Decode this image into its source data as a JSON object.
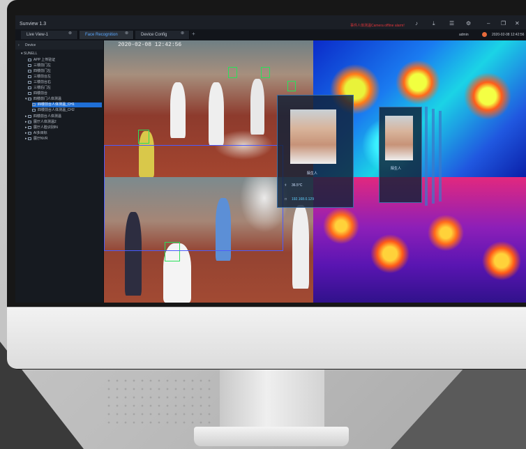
{
  "app": {
    "title": "Sunview 1.3",
    "alarm_text": "事件人体测温Camera offline alarm!",
    "user": "admin",
    "datetime": "2020-02-08 12:42:56"
  },
  "tabs": [
    {
      "label": "Live View-1",
      "active": false
    },
    {
      "label": "Face Recognition",
      "active": true
    },
    {
      "label": "Device Config",
      "active": false
    }
  ],
  "sidebar": {
    "header": "Device",
    "items": [
      {
        "label": "SUNELL",
        "level": 0
      },
      {
        "label": "APP 上传验证",
        "level": 1
      },
      {
        "label": "三楼前门左",
        "level": 1
      },
      {
        "label": "四楼前门左",
        "level": 1
      },
      {
        "label": "三楼前台左",
        "level": 1
      },
      {
        "label": "三楼前台右",
        "level": 1
      },
      {
        "label": "三楼后门左",
        "level": 1
      },
      {
        "label": "四楼前台",
        "level": 1
      },
      {
        "label": "四楼前门人体测温",
        "level": 1
      },
      {
        "label": "四楼前台人体测温_CH1",
        "level": 2,
        "selected": true
      },
      {
        "label": "四楼前台人体测温_CH2",
        "level": 2
      },
      {
        "label": "四楼前台人体测温",
        "level": 1
      },
      {
        "label": "展厅人体测温2",
        "level": 1
      },
      {
        "label": "展厅人脸识别IN",
        "level": 1
      },
      {
        "label": "AI多目标",
        "level": 1
      },
      {
        "label": "展厅NVR",
        "level": 1
      }
    ]
  },
  "video": {
    "timestamp": "2020-02-08 12:42:56",
    "popup_main": {
      "name": "陌生人",
      "temperature": "36.5°C",
      "ip": "192.168.0.129"
    },
    "popup_side": {
      "name": "陌生人"
    }
  },
  "colors": {
    "accent": "#1f6fd6",
    "alarm": "#e0353a",
    "face_box": "#29e05a"
  },
  "icons": [
    "bell-icon",
    "download-icon",
    "menu-icon",
    "settings-icon",
    "minimize-icon",
    "restore-icon",
    "close-icon"
  ]
}
